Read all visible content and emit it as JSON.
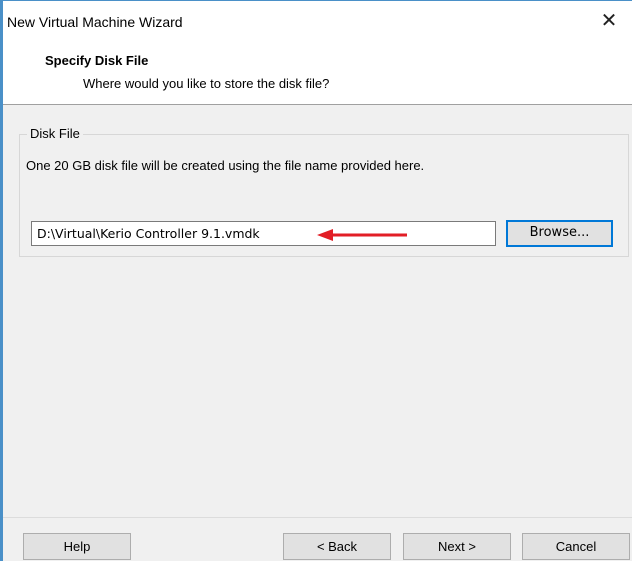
{
  "window": {
    "title": "New Virtual Machine Wizard",
    "close_glyph": "✕"
  },
  "header": {
    "title": "Specify Disk File",
    "subtitle": "Where would you like to store the disk file?"
  },
  "disk_file": {
    "group_label": "Disk File",
    "description": "One 20 GB disk file will be created using the file name provided here.",
    "path_value": "D:\\Virtual\\Kerio Controller 9.1.vmdk",
    "browse_label": "Browse...",
    "annotation": "red-arrow-icon"
  },
  "footer": {
    "help_label": "Help",
    "back_label": "< Back",
    "next_label": "Next >",
    "cancel_label": "Cancel"
  },
  "colors": {
    "accent": "#0078d7",
    "window_border": "#4a90c8",
    "annotation_arrow": "#e21e26"
  }
}
